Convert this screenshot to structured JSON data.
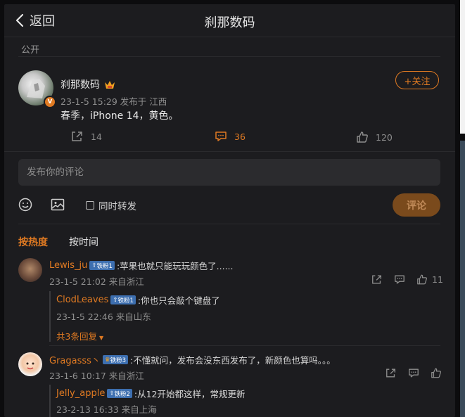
{
  "header": {
    "back_label": "返回",
    "title": "刹那数码"
  },
  "visibility": "公开",
  "post": {
    "author": "刹那数码",
    "meta": "23-1-5 15:29  发布于 江西",
    "text": "春季，iPhone 14，黄色。",
    "follow_label": "+关注",
    "repost_count": "14",
    "comment_count": "36",
    "like_count": "120"
  },
  "composer": {
    "placeholder": "发布你的评论",
    "repost_label": "同时转发",
    "submit_label": "评论"
  },
  "sort_tabs": {
    "hot": "按热度",
    "time": "按时间"
  },
  "comments": [
    {
      "name": "Lewis_ju",
      "badge": "铁粉1",
      "text": ":苹果也就只能玩玩颜色了......",
      "meta": "23-1-5 21:02 来自浙江",
      "like_count": "11",
      "reply": {
        "name": "ClodLeaves",
        "badge": "铁粉1",
        "text": ":你也只会敲个键盘了",
        "meta": "23-1-5 22:46 来自山东"
      },
      "more_label": "共3条回复"
    },
    {
      "name": "Gragasss丶",
      "badge": "铁粉3",
      "text": ":不懂就问，发布会没东西发布了，新颜色也算吗。。。",
      "meta": "23-1-6 10:17 来自浙江",
      "reply": {
        "name": "Jelly_apple",
        "badge": "铁粉2",
        "text": ":从12开始都这样，常规更新",
        "meta": "23-2-13 16:33 来自上海"
      }
    }
  ],
  "colors": {
    "accent": "#e07a22",
    "bg": "#1c1c1f",
    "badge": "#3d6fb0"
  }
}
